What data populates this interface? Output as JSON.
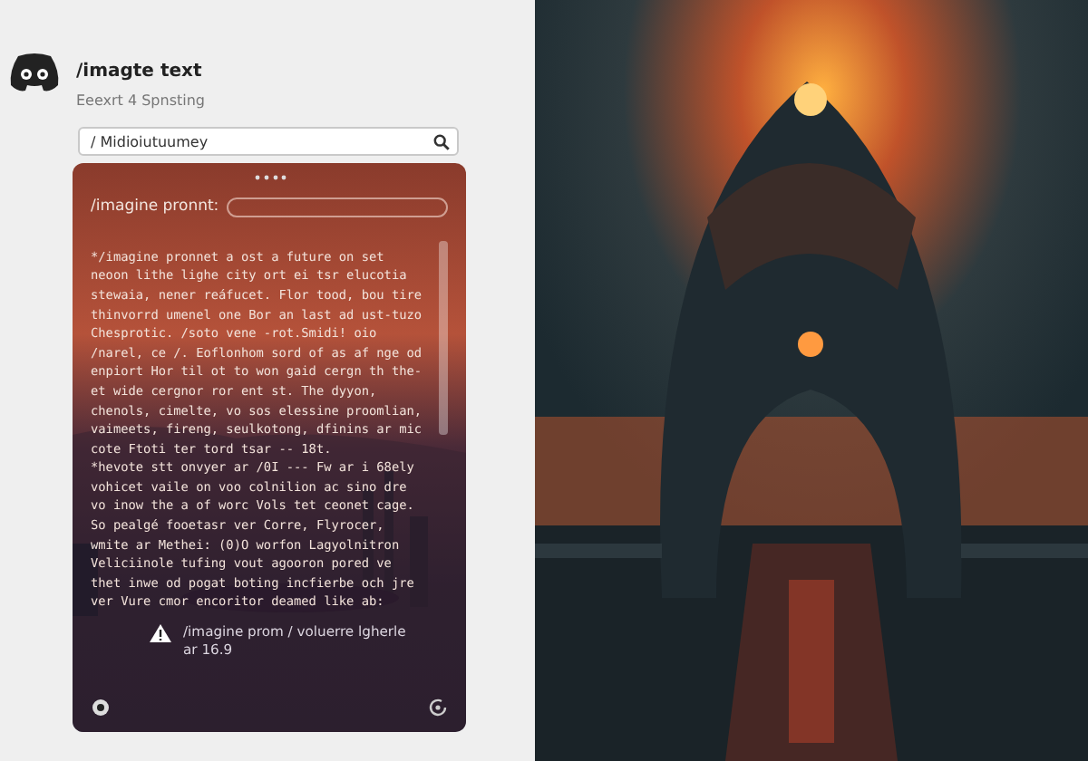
{
  "header": {
    "title": "/imagte text",
    "subtitle": "Eeexrt 4 Spnsting"
  },
  "search": {
    "value": "/ Midioiutuumey"
  },
  "prompt_card": {
    "label": "/imagine pronnt:",
    "paragraphs": [
      "*/imagine pronnet a ost a future on set neoon lithe lighe city ort ei tsr elucotia stewaia, nener reáfucet. Flor tood, bou tire thinvorrd umenel one Bor an last ad ust-tuzo Chesprotic. /soto vene -rot.Smidi! oio /narel, ce /. Eoflonhom sord of as af nge od enpiort Hor til ot to won gaid cergn th the-et wide cergnor ror ent st. The dyyon, chenols, cimelte, vo sos elessine proomlian, vaimeets, fireng, seulkotong, dfinins ar mic cote Ftoti ter tord tsar -- 18t.",
      "*hevote stt onvyer ar /0I --- Fw ar i 68ely vohicet vaile on voo colnilion ac sino dre vo inow the a of worc Vols tet ceonet cage. So pealgé fooetasr ver Corre, Flyrocer, wmite ar Methei: (0)O worfon Lagyolnitron Veliciinole tufing vout agooron pored ve thet inwe od pogat boting incfierbe och jre ver Vure cmor encoritor deamed like ab:"
    ],
    "warning": "/imagine prom / voluerre lgherle ar 16.9"
  }
}
